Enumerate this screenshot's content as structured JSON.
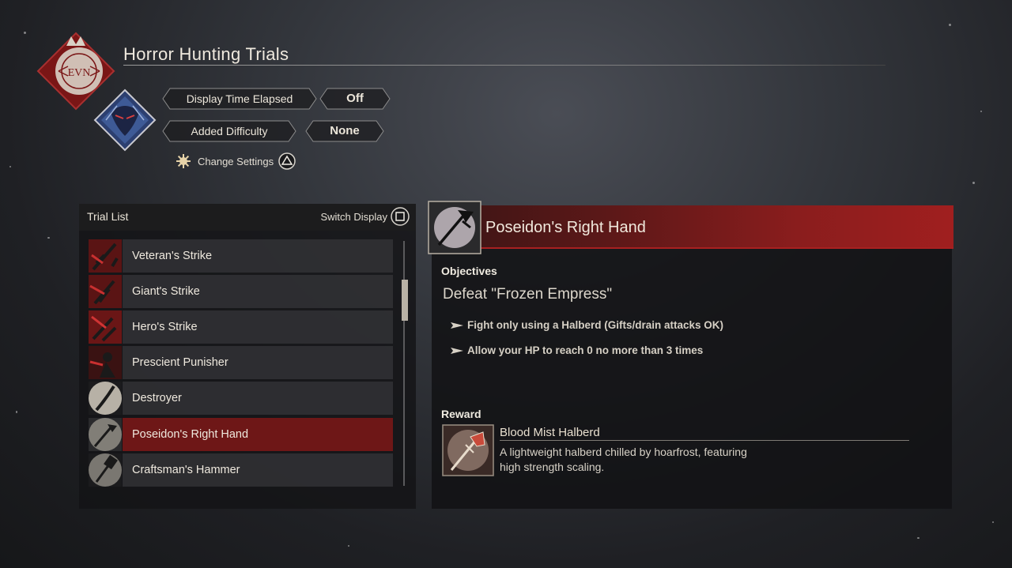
{
  "header": {
    "title": "Horror Hunting Trials",
    "emblem_text": "EVN"
  },
  "settings": {
    "time_label": "Display Time Elapsed",
    "time_value": "Off",
    "difficulty_label": "Added Difficulty",
    "difficulty_value": "None",
    "change_label": "Change Settings",
    "change_button_icon": "triangle-button-icon"
  },
  "trial_list": {
    "title": "Trial List",
    "switch_label": "Switch Display",
    "switch_button_icon": "square-button-icon",
    "items": [
      {
        "label": "Veteran's Strike"
      },
      {
        "label": "Giant's Strike"
      },
      {
        "label": "Hero's Strike"
      },
      {
        "label": "Prescient Punisher"
      },
      {
        "label": "Destroyer"
      },
      {
        "label": "Poseidon's Right Hand",
        "selected": true
      },
      {
        "label": "Craftsman's Hammer"
      }
    ]
  },
  "detail": {
    "title": "Poseidon's Right Hand",
    "objectives_label": "Objectives",
    "objective_main": "Defeat \"Frozen Empress\"",
    "objectives": [
      "Fight only using a Halberd (Gifts/drain attacks OK)",
      "Allow your HP to reach 0 no more than 3 times"
    ],
    "reward_label": "Reward",
    "reward_name": "Blood Mist Halberd",
    "reward_description": "A lightweight halberd chilled by hoarfrost, featuring high strength scaling."
  },
  "colors": {
    "accent_red": "#8a1d1d",
    "selected_row": "#6e1717",
    "text": "#efe9de"
  }
}
